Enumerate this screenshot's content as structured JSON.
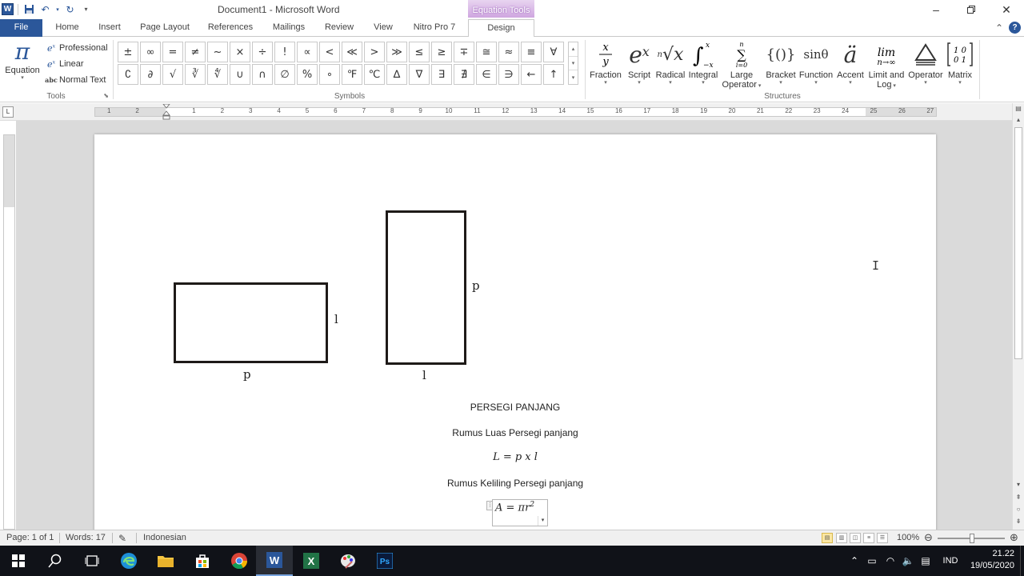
{
  "title_bar": {
    "document_title": "Document1  -  Microsoft Word",
    "contextual_tab": "Equation Tools"
  },
  "tabs": [
    {
      "label": "File"
    },
    {
      "label": "Home"
    },
    {
      "label": "Insert"
    },
    {
      "label": "Page Layout"
    },
    {
      "label": "References"
    },
    {
      "label": "Mailings"
    },
    {
      "label": "Review"
    },
    {
      "label": "View"
    },
    {
      "label": "Nitro Pro 7"
    },
    {
      "label": "Design"
    }
  ],
  "ribbon": {
    "tools": {
      "equation_label": "Equation",
      "options": [
        "Professional",
        "Linear",
        "Normal Text"
      ],
      "group_label": "Tools"
    },
    "symbols": {
      "group_label": "Symbols",
      "items": [
        "±",
        "∞",
        "=",
        "≠",
        "~",
        "×",
        "÷",
        "!",
        "∝",
        "<",
        "≪",
        ">",
        "≫",
        "≤",
        "≥",
        "∓",
        "≅",
        "≈",
        "≡",
        "∀",
        "∁",
        "∂",
        "√",
        "∛",
        "∜",
        "∪",
        "∩",
        "∅",
        "%",
        "∘",
        "℉",
        "℃",
        "∆",
        "∇",
        "∃",
        "∄",
        "∈",
        "∋",
        "←",
        "↑"
      ]
    },
    "structures": {
      "group_label": "Structures",
      "items": [
        {
          "label": "Fraction",
          "icon": "fraction-icon"
        },
        {
          "label": "Script",
          "icon": "script-icon"
        },
        {
          "label": "Radical",
          "icon": "radical-icon"
        },
        {
          "label": "Integral",
          "icon": "integral-icon"
        },
        {
          "label": "Large",
          "label2": "Operator",
          "icon": "large-operator-icon"
        },
        {
          "label": "Bracket",
          "icon": "bracket-icon"
        },
        {
          "label": "Function",
          "icon": "function-icon"
        },
        {
          "label": "Accent",
          "icon": "accent-icon"
        },
        {
          "label": "Limit and",
          "label2": "Log",
          "icon": "limit-log-icon"
        },
        {
          "label": "Operator",
          "icon": "operator-icon"
        },
        {
          "label": "Matrix",
          "icon": "matrix-icon"
        }
      ]
    }
  },
  "ruler_numbers": [
    "1",
    "2",
    "1",
    "2",
    "3",
    "4",
    "5",
    "6",
    "7",
    "8",
    "9",
    "10",
    "11",
    "12",
    "13",
    "14",
    "15",
    "16",
    "17",
    "18",
    "19",
    "20",
    "21",
    "22",
    "23",
    "24",
    "25",
    "26",
    "27"
  ],
  "document": {
    "shape_labels": {
      "rect1_width": "p",
      "rect1_height": "l",
      "rect2_height": "p",
      "rect2_width": "l"
    },
    "heading": "PERSEGI PANJANG",
    "area_caption": "Rumus Luas Persegi panjang",
    "area_formula": "L = p x l",
    "perimeter_caption": "Rumus Keliling Persegi panjang",
    "equation_box": {
      "text": "A = πr",
      "exponent": "2"
    }
  },
  "status_bar": {
    "page": "Page: 1 of 1",
    "words": "Words: 17",
    "language": "Indonesian",
    "zoom": "100%"
  },
  "taskbar": {
    "language": "IND",
    "time": "21.22",
    "date": "19/05/2020"
  },
  "colors": {
    "word_blue": "#2b579a",
    "contextual_purple": "#cfa6e0",
    "shape_stroke": "#1e1a18"
  }
}
